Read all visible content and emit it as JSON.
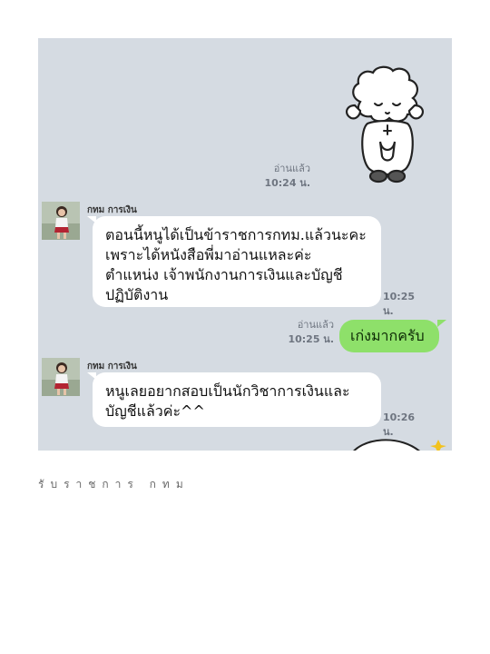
{
  "chat": {
    "messages": [
      {
        "type": "sticker",
        "direction": "out",
        "sticker_icon": "sheep-bowing-sticker",
        "read_label": "อ่านแล้ว",
        "time": "10:24 น."
      },
      {
        "type": "text",
        "direction": "in",
        "sender": "กทม การเงิน",
        "lines": [
          "ตอนนี้หนูได้เป็นข้าราชการกทม.แล้วนะคะ",
          "เพราะได้หนังสือพี่มาอ่านแหละค่ะ",
          "ตำแหน่ง เจ้าพนักงานการเงินและบัญชี",
          "ปฏิบัติงาน"
        ],
        "time": "10:25 น."
      },
      {
        "type": "text",
        "direction": "out",
        "text": "เก่งมากครับ",
        "read_label": "อ่านแล้ว",
        "time": "10:25 น."
      },
      {
        "type": "text",
        "direction": "in",
        "sender": "กทม การเงิน",
        "lines": [
          "หนูเลยอยากสอบเป็นนักวิชาการเงินและ",
          "บัญชีแล้วค่ะ^^"
        ],
        "time": "10:26 น."
      }
    ],
    "colors": {
      "background": "#d5dbe2",
      "incoming_bubble": "#ffffff",
      "outgoing_bubble": "#8ee06a"
    }
  },
  "caption": "รับราชการ กทม"
}
